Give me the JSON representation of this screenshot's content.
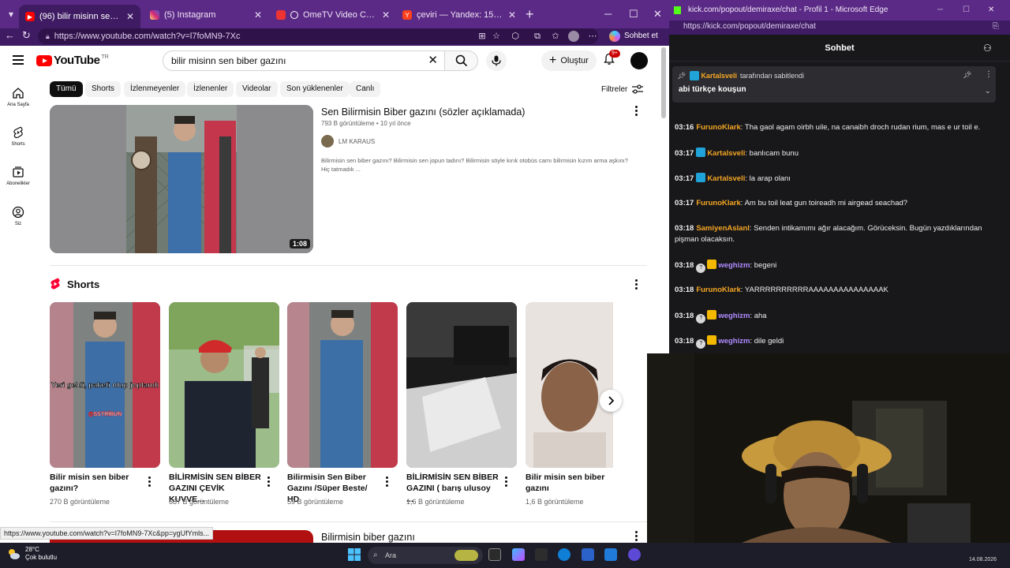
{
  "left_window": {
    "tabs": [
      {
        "label": "(96) bilir misinn sen biber gazını",
        "active": true,
        "favicon": "youtube-icon"
      },
      {
        "label": "(5) Instagram",
        "active": false,
        "favicon": "instagram-icon"
      },
      {
        "label": "OmeTV Video Chat — Omegl",
        "active": false,
        "favicon": "ometv-icon"
      },
      {
        "label": "çeviri — Yandex: 159 bin sonuç bu",
        "active": false,
        "favicon": "yandex-icon"
      }
    ],
    "url": "https://www.youtube.com/watch?v=l7foMN9-7Xc",
    "copilot_label": "Sohbet et"
  },
  "youtube": {
    "logo_text": "YouTube",
    "country_code": "TR",
    "search_query": "bilir misinn sen biber gazını",
    "create_label": "Oluştur",
    "notif_badge": "9+",
    "guide": [
      {
        "label": "Ana Sayfa",
        "icon": "home-icon"
      },
      {
        "label": "Shorts",
        "icon": "shorts-icon"
      },
      {
        "label": "Abonelikler",
        "icon": "subscriptions-icon"
      },
      {
        "label": "Siz",
        "icon": "you-icon"
      }
    ],
    "chips": [
      "Tümü",
      "Shorts",
      "İzlenmeyenler",
      "İzlenenler",
      "Videolar",
      "Son yüklenenler",
      "Canlı"
    ],
    "filters_label": "Filtreler",
    "video1": {
      "title": "Sen Bilirmisin Biber gazını (sözler açıklamada)",
      "views": "793 B görüntüleme",
      "age": "10 yıl önce",
      "channel": "LM KARAUS",
      "description": "Bilirmisin sen biber gazını? Bilirmisin sen jopun tadını? Bilirmisin söyle kırık otobüs camı bilirmisin kızım arma aşkını? Hiç tatmadık ...",
      "duration": "1:08"
    },
    "shorts_heading": "Shorts",
    "shorts": [
      {
        "title": "Bilir misin sen biber gazını?",
        "views": "270 B görüntüleme",
        "overlay": "Yeri geldi, paketi olup joplandı",
        "watermark": "@SSTRİBUN"
      },
      {
        "title": "BİLİRMİSİN SEN BİBER GAZINI ÇEVİK KUVVE...",
        "views": "687 B görüntüleme"
      },
      {
        "title": "Bilirmisin Sen Biber Gazını /Süper Beste/ HD",
        "views": "59 B görüntüleme"
      },
      {
        "title": "BİLİRMİSİN SEN BİBER GAZINI ( barış ulusoy ...",
        "views": "1,6 B görüntüleme"
      },
      {
        "title": "Bilir misin sen biber gazını",
        "views": "1,6 B görüntüleme"
      }
    ],
    "video2_title": "Bilirmisin biber gazını",
    "status_url": "https://www.youtube.com/watch?v=l7foMN9-7Xc&pp=ygUfYmls..."
  },
  "right_window": {
    "title": "kick.com/popout/demiraxe/chat - Profil 1 - Microsoft Edge",
    "url": "https://kick.com/popout/demiraxe/chat",
    "header": "Sohbet",
    "pinned_by_user": "Kartalsveli",
    "pinned_by_suffix": "tarafından sabitlendi",
    "pinned_text": "abi türkçe kouşun",
    "messages": [
      {
        "time": "03:16",
        "user": "FurunoKlark",
        "color": "#f5a623",
        "badge": "",
        "text": "Tha gaol agam oirbh uile, na canaibh droch rudan rium, mas e ur toil e."
      },
      {
        "time": "03:17",
        "user": "Kartalsveli",
        "color": "#f5a623",
        "badge": "kick",
        "text": "banlıcam bunu"
      },
      {
        "time": "03:17",
        "user": "Kartalsveli",
        "color": "#f5a623",
        "badge": "kick",
        "text": "la arap olanı"
      },
      {
        "time": "03:17",
        "user": "FurunoKlark",
        "color": "#f5a623",
        "badge": "",
        "text": "Am bu toil leat gun toireadh mi airgead seachad?"
      },
      {
        "time": "03:18",
        "user": "SamiyenAslanl",
        "color": "#f5a623",
        "badge": "",
        "text": "Senden intikamımı ağır alacağım. Görüceksin. Bugün yazdıklarından pişman olacaksın."
      },
      {
        "time": "03:18",
        "user": "weghizm",
        "color": "#b18cff",
        "badge": "sub",
        "text": "begeni"
      },
      {
        "time": "03:18",
        "user": "FurunoKlark",
        "color": "#f5a623",
        "badge": "",
        "text": "YARRRRRRRRRRAAAAAAAAAAAAAAAK"
      },
      {
        "time": "03:18",
        "user": "weghizm",
        "color": "#b18cff",
        "badge": "sub",
        "text": "aha"
      },
      {
        "time": "03:18",
        "user": "weghizm",
        "color": "#b18cff",
        "badge": "sub",
        "text": "dile geldi"
      }
    ]
  },
  "taskbar": {
    "temperature": "28°C",
    "condition": "Çok bulutlu",
    "search_placeholder": "Ara",
    "date": "14.08.2026"
  }
}
